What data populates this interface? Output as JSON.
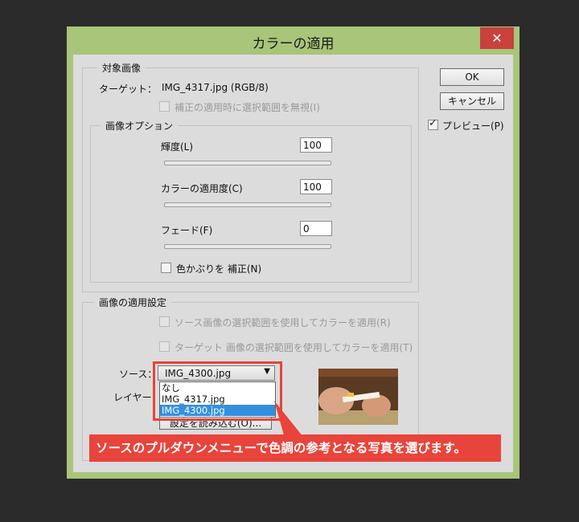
{
  "dialog": {
    "title": "カラーの適用",
    "close_glyph": "✕"
  },
  "target_group": {
    "title": "対象画像",
    "target_label": "ターゲット：",
    "target_value": "IMG_4317.jpg (RGB/8)",
    "ignore_selection": "補正の適用時に選択範囲を無視(I)"
  },
  "image_options": {
    "title": "画像オプション",
    "luminance": {
      "label": "輝度(L)",
      "value": "100",
      "level": 100,
      "min": 1,
      "max": 200
    },
    "color_intensity": {
      "label": "カラーの適用度(C)",
      "value": "100",
      "level": 100,
      "min": 1,
      "max": 200
    },
    "fade": {
      "label": "フェード(F)",
      "value": "0",
      "level": 0,
      "min": 0,
      "max": 100
    },
    "neutralize": "色かぶりを 補正(N)"
  },
  "buttons": {
    "ok": "OK",
    "cancel": "キャンセル"
  },
  "preview": {
    "label": "プレビュー(P)",
    "checked": true
  },
  "stats_group": {
    "title": "画像の適用設定",
    "use_source_selection": "ソース画像の選択範囲を使用してカラーを適用(R)",
    "use_target_selection": "ターゲット 画像の選択範囲を使用してカラーを適用(T)",
    "source_label": "ソース：",
    "source_value": "IMG_4300.jpg",
    "layer_label": "レイヤー：",
    "source_options": [
      "なし",
      "IMG_4317.jpg",
      "IMG_4300.jpg"
    ],
    "selected_index": 2,
    "load_stats_button": "設定を読み込む(O)..."
  },
  "callout": {
    "text": "ソースのプルダウンメニューで色調の参考となる写真を選びます。"
  },
  "colors": {
    "accent": "#e8443b",
    "selection": "#3390e0",
    "frame": "#a8c57a"
  }
}
